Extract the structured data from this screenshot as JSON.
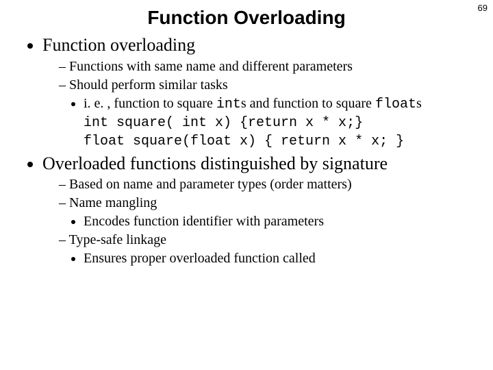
{
  "page_number": "69",
  "title": "Function Overloading",
  "b1": {
    "text": "Function overloading",
    "s1": "Functions with same name and different parameters",
    "s2": "Should perform similar tasks",
    "s2a_pre": "i. e. , function to square ",
    "s2a_code1": "int",
    "s2a_mid": "s and function to square ",
    "s2a_code2": "float",
    "s2a_post": "s",
    "code1": "int square( int x) {return x * x;}",
    "code2": "float square(float x) { return x * x; }"
  },
  "b2": {
    "text": "Overloaded functions distinguished by signature",
    "s1": "Based on name and parameter types (order matters)",
    "s2": "Name mangling",
    "s2a": "Encodes function identifier with parameters",
    "s3": "Type-safe linkage",
    "s3a": "Ensures proper overloaded function called"
  }
}
